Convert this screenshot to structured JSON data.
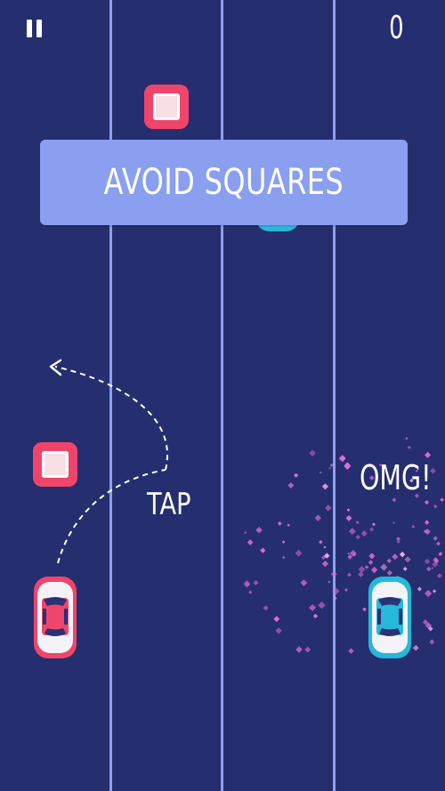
{
  "hud": {
    "score": "0",
    "pause_icon": "pause-icon"
  },
  "banner": {
    "text": "AVOID SQUARES"
  },
  "hints": {
    "tap": "TAP",
    "omg": "OMG!"
  },
  "colors": {
    "background": "#252e6f",
    "lane_line": "#8c9ff0",
    "red_car": "#f0456a",
    "blue_car": "#25b8d8",
    "banner": "#8a9ff0",
    "particle": "#e36bd8"
  },
  "icons": [
    "pause-icon",
    "red-car",
    "blue-car",
    "square-obstacle",
    "tap-arrow-icon",
    "particle-burst"
  ]
}
